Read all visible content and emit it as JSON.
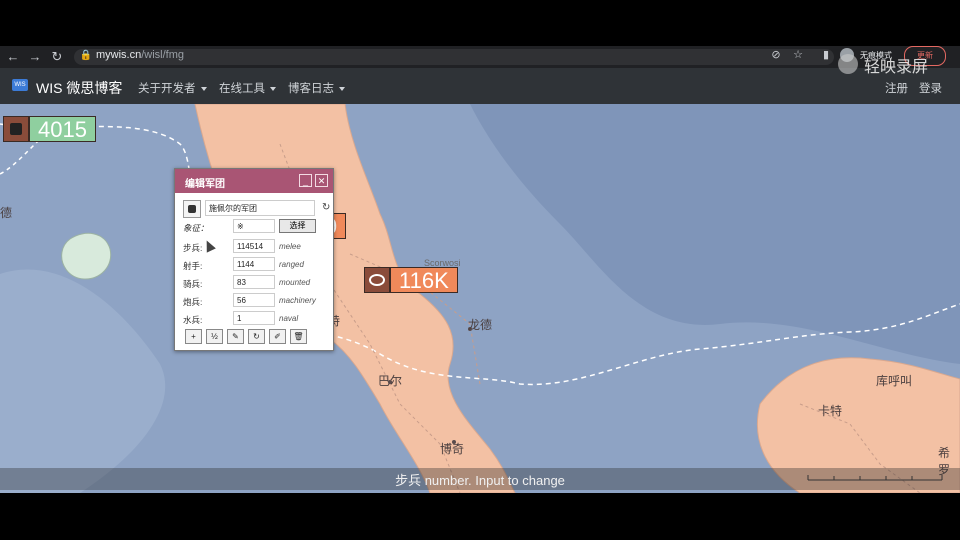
{
  "browser": {
    "url_host": "mywis.cn",
    "url_path": "/wisl/fmg",
    "profile_label": "无痕模式",
    "update_label": "更新"
  },
  "site": {
    "logo_text": "WIS",
    "brand": "WIS 微思博客",
    "menu": [
      {
        "label": "关于开发者"
      },
      {
        "label": "在线工具"
      },
      {
        "label": "博客日志"
      }
    ],
    "register": "注册",
    "login": "登录"
  },
  "watermark": "轻映录屏",
  "map": {
    "labels": [
      "Scorwosi",
      "龙德",
      "巴尔",
      "博奇",
      "卡特",
      "库呼叫",
      "希罗",
      "德",
      "特"
    ],
    "markers": [
      {
        "value": "4015",
        "bg": "#8fcf9f",
        "icon": "army-icon"
      },
      {
        "value": "116K",
        "bg": "#f0895a",
        "icon": "skull-icon"
      },
      {
        "value": "9",
        "bg": "#f0895a",
        "icon": "army-icon"
      }
    ]
  },
  "dialog": {
    "title": "编辑军团",
    "name_value": "施佩尔的军团",
    "emblem_label": "象征：",
    "emblem_value": "※",
    "select_label": "选择",
    "rows": [
      {
        "label": "步兵:",
        "value": "114514",
        "hint": "melee"
      },
      {
        "label": "射手:",
        "value": "1144",
        "hint": "ranged"
      },
      {
        "label": "骑兵:",
        "value": "83",
        "hint": "mounted"
      },
      {
        "label": "炮兵:",
        "value": "56",
        "hint": "machinery"
      },
      {
        "label": "水兵:",
        "value": "1",
        "hint": "naval"
      }
    ],
    "toolbar": [
      "+",
      "½",
      "✎",
      "↻",
      "✐",
      "🗑"
    ],
    "close_glyph": "✕",
    "minimize_glyph": "_",
    "refresh_glyph": "↻"
  },
  "subtitle": "步兵 number. Input to change",
  "colors": {
    "dialog_title": "#a95574",
    "land": "#f3c1a4",
    "water": "#8ea3c4"
  }
}
